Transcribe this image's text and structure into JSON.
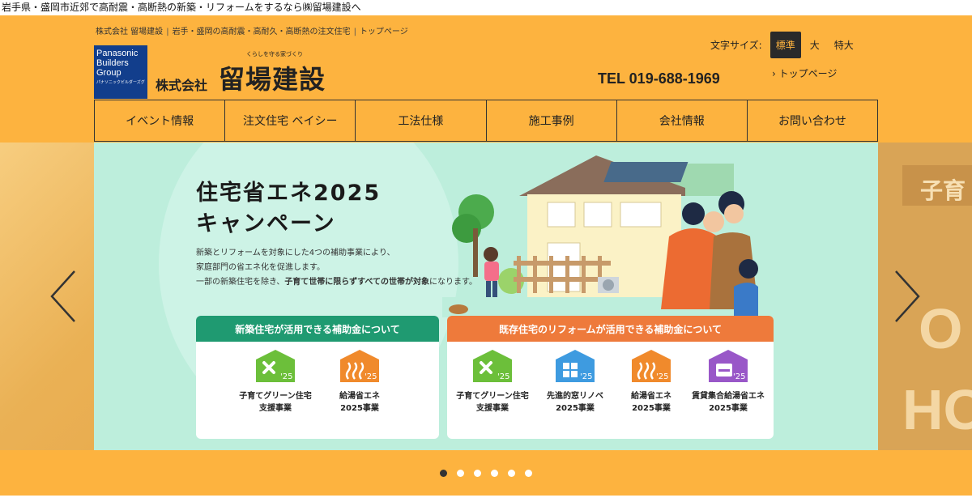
{
  "page": {
    "top_line": "岩手県・盛岡市近郊で高耐震・高断熱の新築・リフォームをするなら㈱留場建設へ"
  },
  "header": {
    "breadcrumb": [
      "株式会社 留場建設",
      "岩手・盛岡の高耐震・高耐久・高断熱の注文住宅",
      "トップページ"
    ],
    "logo_lines": [
      "Panasonic",
      "Builders",
      "Group",
      "パナソニックビルダーズグループ"
    ],
    "company_tagline": "くらしを守る家づくり",
    "company_prefix": "株式会社",
    "company_name": "留場建設",
    "font_size_label": "文字サイズ:",
    "font_size_options": [
      "標準",
      "大",
      "特大"
    ],
    "font_size_selected": "標準",
    "tel": "TEL 019-688-1969",
    "top_page_link": "トップページ",
    "brand_color": "#fdb33f"
  },
  "nav": {
    "items": [
      "イベント情報",
      "注文住宅 ベイシー",
      "工法仕様",
      "施工事例",
      "会社情報",
      "お問い合わせ"
    ]
  },
  "slider": {
    "title_line1": "住宅省エネ2025",
    "title_line2": "キャンペーン",
    "desc_line1": "新築とリフォームを対象にした4つの補助事業により、",
    "desc_line2": "家庭部門の省エネ化を促進します。",
    "desc_line3_pre": "一部の新築住宅を除き、",
    "desc_line3_bold": "子育て世帯に限らずすべての世帯が対象",
    "desc_line3_post": "になります。",
    "side_right_texts": [
      "子育",
      "O",
      "HO"
    ],
    "new_card": {
      "title": "新築住宅が活用できる補助金について",
      "programs": [
        {
          "line1": "子育てグリーン住宅",
          "line2": "支援事業",
          "year": "'25",
          "color": "#6cbf3a"
        },
        {
          "line1": "給湯省エネ",
          "line2": "2025事業",
          "year": "'25",
          "color": "#f08a2c"
        }
      ]
    },
    "reform_card": {
      "title": "既存住宅のリフォームが活用できる補助金について",
      "programs": [
        {
          "line1": "子育てグリーン住宅",
          "line2": "支援事業",
          "year": "'25",
          "color": "#6cbf3a"
        },
        {
          "line1": "先進的窓リノベ",
          "line2": "2025事業",
          "year": "'25",
          "color": "#3e9be0"
        },
        {
          "line1": "給湯省エネ",
          "line2": "2025事業",
          "year": "'25",
          "color": "#f08a2c"
        },
        {
          "line1": "賃貸集合給湯省エネ",
          "line2": "2025事業",
          "year": "'25",
          "color": "#9957c8"
        }
      ]
    },
    "dots_count": 6,
    "active_dot": 1
  },
  "icons": {
    "prev": "chevron-left-icon",
    "next": "chevron-right-icon",
    "toplink": "chevron-right-small-icon",
    "program_green": "crossed-leaves-house-icon",
    "program_window": "window-house-icon",
    "program_water": "hot-water-house-icon",
    "program_rental": "rental-unit-house-icon"
  }
}
